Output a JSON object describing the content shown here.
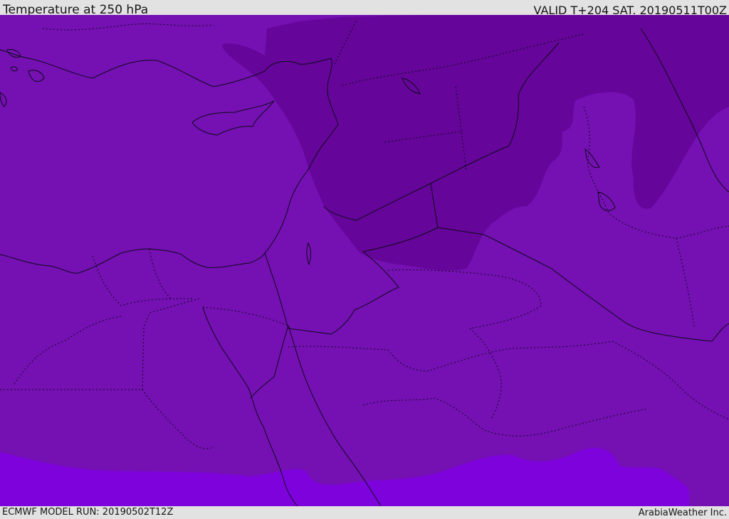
{
  "header": {
    "title": "Temperature at 250 hPa",
    "valid_time": "VALID T+204 SAT. 20190511T00Z"
  },
  "footer": {
    "model_run": "ECMWF MODEL RUN: 20190502T12Z",
    "credit": "ArabiaWeather Inc."
  },
  "map": {
    "fill_colors": {
      "base": "#7510b3",
      "cold": "#66059a",
      "warm": "#7d02dc",
      "boundary": "#0b0b18"
    }
  }
}
